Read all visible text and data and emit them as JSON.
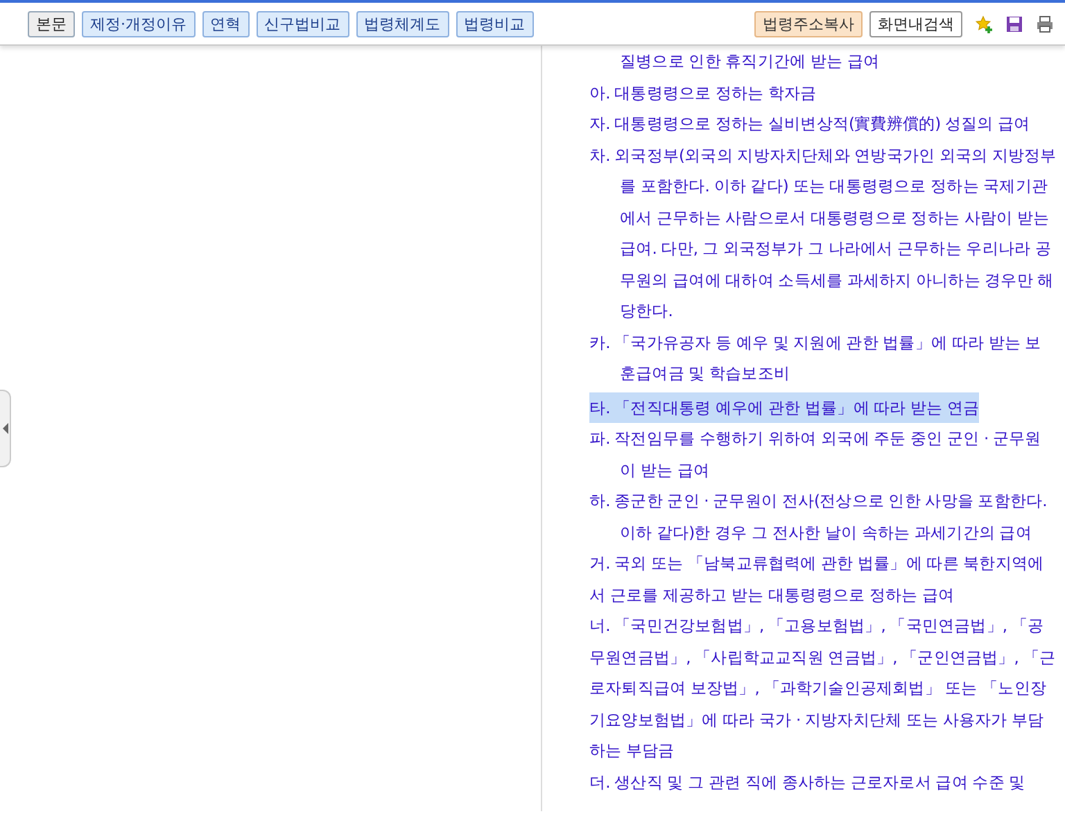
{
  "toolbar": {
    "buttons": [
      {
        "label": "본문",
        "kind": "plain"
      },
      {
        "label": "제정·개정이유",
        "kind": "blue"
      },
      {
        "label": "연혁",
        "kind": "blue"
      },
      {
        "label": "신구법비교",
        "kind": "blue"
      },
      {
        "label": "법령체계도",
        "kind": "blue"
      },
      {
        "label": "법령비교",
        "kind": "blue"
      }
    ],
    "tools": [
      {
        "label": "법령주소복사",
        "kind": "orange"
      },
      {
        "label": "화면내검색",
        "kind": "white"
      }
    ]
  },
  "items": [
    {
      "kind": "continuation",
      "marker": "",
      "text": "질병으로 인한 휴직기간에 받는 급여",
      "selected": false
    },
    {
      "kind": "hanging",
      "marker": "아.",
      "text": "대통령령으로 정하는 학자금",
      "selected": false
    },
    {
      "kind": "hanging",
      "marker": "자.",
      "text": "대통령령으로 정하는 실비변상적(實費辨償的) 성질의 급여",
      "selected": false
    },
    {
      "kind": "hanging",
      "marker": "차.",
      "text": "외국정부(외국의 지방자치단체와 연방국가인 외국의 지방정부를 포함한다. 이하 같다) 또는 대통령령으로 정하는 국제기관에서 근무하는 사람으로서 대통령령으로 정하는 사람이 받는 급여. 다만, 그 외국정부가 그 나라에서 근무하는 우리나라 공무원의 급여에 대하여 소득세를 과세하지 아니하는 경우만 해당한다.",
      "selected": false
    },
    {
      "kind": "hanging",
      "marker": "카.",
      "text": "「국가유공자 등 예우 및 지원에 관한 법률」에 따라 받는 보훈급여금 및 학습보조비",
      "selected": false
    },
    {
      "kind": "hanging",
      "marker": "타.",
      "text": "「전직대통령 예우에 관한 법률」에 따라 받는 연금",
      "selected": true
    },
    {
      "kind": "hanging",
      "marker": "파.",
      "text": "작전임무를 수행하기 위하여 외국에 주둔 중인 군인 · 군무원이 받는 급여",
      "selected": false
    },
    {
      "kind": "hanging",
      "marker": "하.",
      "text": "종군한 군인 · 군무원이 전사(전상으로 인한 사망을 포함한다. 이하 같다)한 경우 그 전사한 날이 속하는 과세기간의 급여",
      "selected": false
    },
    {
      "kind": "flat",
      "marker": "거.",
      "text": "국외 또는 「남북교류협력에 관한 법률」에 따른 북한지역에서 근로를 제공하고 받는 대통령령으로 정하는 급여",
      "selected": false
    },
    {
      "kind": "flat",
      "marker": "너.",
      "text": "「국민건강보험법」, 「고용보험법」, 「국민연금법」, 「공무원연금법」, 「사립학교교직원 연금법」, 「군인연금법」, 「근로자퇴직급여 보장법」, 「과학기술인공제회법」 또는 「노인장기요양보험법」에 따라 국가 · 지방자치단체 또는 사용자가 부담하는 부담금",
      "selected": false
    },
    {
      "kind": "flat",
      "marker": "더.",
      "text": "생산직 및 그 관련 직에 종사하는 근로자로서 급여 수준 및",
      "selected": false
    }
  ]
}
